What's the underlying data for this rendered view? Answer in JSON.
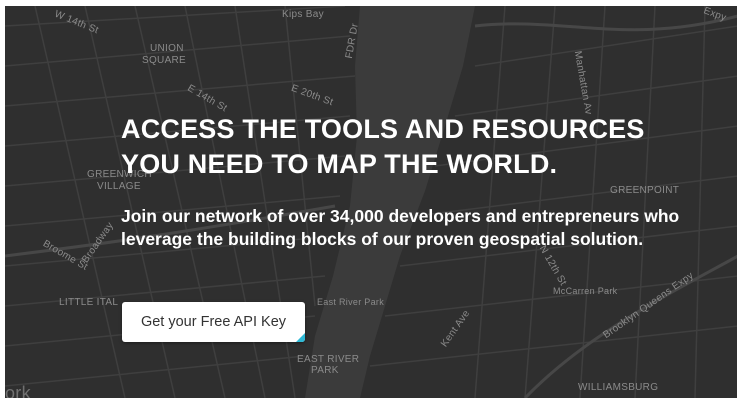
{
  "hero": {
    "headline_line1": "ACCESS THE TOOLS AND RESOURCES",
    "headline_line2": "YOU NEED TO MAP THE WORLD.",
    "subtext": "Join our network of over 34,000 developers and entrepreneurs who leverage the building blocks of our proven geospatial solution.",
    "cta_label": "Get your Free API Key",
    "accent_color": "#2eb9d6",
    "background_color": "#2f2f2f"
  },
  "map": {
    "labels": {
      "kips_bay": "Kips Bay",
      "union_square_1": "UNION",
      "union_square_2": "SQUARE",
      "greenwich_1": "GREENWICH",
      "greenwich_2": "VILLAGE",
      "greenpoint": "GREENPOINT",
      "little_italy": "LITTLE ITAL",
      "east_river_park_small": "East River Park",
      "east_river_park_1": "EAST RIVER",
      "east_river_park_2": "PARK",
      "mccarren_park": "McCarren Park",
      "williamsburg": "WILLIAMSBURG",
      "w14th": "W 14th St",
      "e14th": "E 14th St",
      "e20th": "E 20th St",
      "fdr_dr": "FDR Dr",
      "broadway": "Broadway",
      "broome": "Broome St",
      "bqe": "Brooklyn Queens Expy",
      "manhattan_ave": "Manhattan Av",
      "kent_ave": "Kent Ave",
      "n12th": "N 12th St",
      "york_partial": "ork",
      "expy_partial": "Expy"
    }
  }
}
